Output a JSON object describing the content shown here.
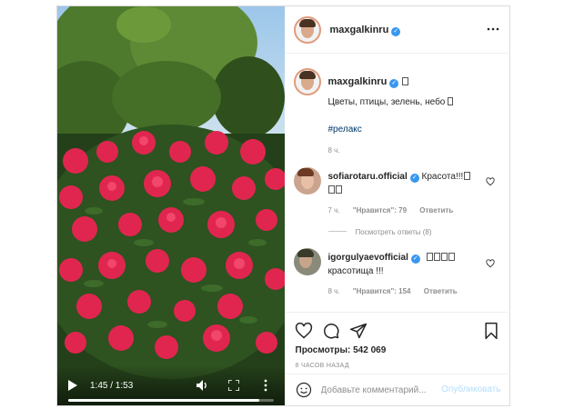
{
  "video": {
    "time": "1:45 / 1:53",
    "progress": 0.93
  },
  "author": {
    "username": "maxgalkinru",
    "verified": true
  },
  "caption": {
    "username": "maxgalkinru",
    "text": "Цветы, птицы, зелень, небо",
    "hashtag": "#релакс",
    "time": "8 ч."
  },
  "comments": [
    {
      "username": "sofiarotaru.official",
      "text": "Красота!!!",
      "time": "7 ч.",
      "likes": "\"Нравится\": 79",
      "reply_label": "Ответить",
      "view_replies": "Посмотреть ответы (8)"
    },
    {
      "username": "igorgulyaevofficial",
      "text": "красотища !!!",
      "time": "8 ч.",
      "likes": "\"Нравится\": 154",
      "reply_label": "Ответить"
    }
  ],
  "stats": {
    "views": "Просмотры: 542 069",
    "posted": "8 ЧАСОВ НАЗАД"
  },
  "add_comment": {
    "placeholder": "Добавьте комментарий...",
    "publish_label": "Опубликовать"
  },
  "icons": {
    "like": "heart-icon",
    "comment": "comment-icon",
    "share": "share-icon",
    "save": "bookmark-icon",
    "options": "more-icon",
    "emoji": "smile-icon"
  },
  "colors": {
    "verified": "#3897f0",
    "link": "#00376b",
    "publish": "#b2dffc",
    "muted": "#8e8e8e"
  }
}
